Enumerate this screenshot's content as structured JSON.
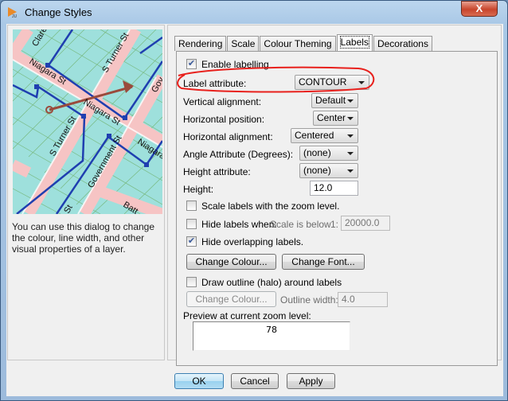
{
  "window": {
    "title": "Change Styles",
    "close_label": "X"
  },
  "preview_map": {
    "street_labels": [
      "Claren",
      "S Turner St",
      "Niagara St",
      "S Turner St",
      "Niagara St",
      "Gov",
      "Niagara",
      "Government St",
      "St",
      "Batt"
    ]
  },
  "description": "You can use this dialog to change the colour, line width, and other visual properties of a layer.",
  "tabs": [
    {
      "label": "Rendering"
    },
    {
      "label": "Scale"
    },
    {
      "label": "Colour Theming"
    },
    {
      "label": "Labels",
      "active": true
    },
    {
      "label": "Decorations"
    }
  ],
  "labels": {
    "enable_labelling": {
      "label": "Enable labelling",
      "checked": true
    },
    "label_attribute": {
      "label": "Label attribute:",
      "value": "CONTOUR"
    },
    "vertical_alignment": {
      "label": "Vertical alignment:",
      "value": "Default"
    },
    "horizontal_position": {
      "label": "Horizontal position:",
      "value": "Center"
    },
    "horizontal_alignment": {
      "label": "Horizontal alignment:",
      "value": "Centered"
    },
    "angle_attribute": {
      "label": "Angle Attribute (Degrees):",
      "value": "(none)"
    },
    "height_attribute": {
      "label": "Height attribute:",
      "value": "(none)"
    },
    "height": {
      "label": "Height:",
      "value": "12.0"
    },
    "scale_labels": {
      "label": "Scale labels with the zoom level.",
      "checked": false
    },
    "hide_labels": {
      "label": "Hide labels when:",
      "condition": "Scale is below",
      "ratio_prefix": "1:",
      "value": "20000.0",
      "checked": false
    },
    "hide_overlapping": {
      "label": "Hide overlapping labels.",
      "checked": true
    },
    "change_colour": "Change Colour...",
    "change_font": "Change Font...",
    "draw_outline": {
      "label": "Draw outline (halo) around labels",
      "checked": false
    },
    "outline_change_colour": "Change Colour...",
    "outline_width": {
      "label": "Outline width:",
      "value": "4.0"
    },
    "preview_label": "Preview at current zoom level:",
    "preview_text": "78"
  },
  "footer": {
    "ok": "OK",
    "cancel": "Cancel",
    "apply": "Apply"
  },
  "colors": {
    "annotation": "#e8201c",
    "map_water": "#9ee0dc",
    "road": "#f4b8b8",
    "line": "#1f3fb0"
  }
}
